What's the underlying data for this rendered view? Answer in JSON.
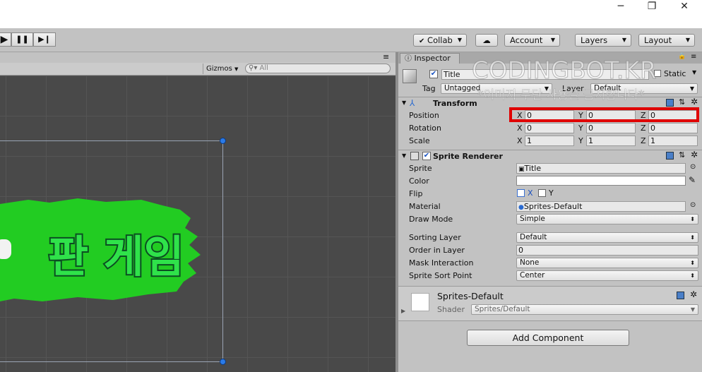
{
  "window": {
    "minimize": "─",
    "restore": "❐",
    "close": "✕"
  },
  "toolbar": {
    "play_icon": "▶",
    "pause_icon": "❚❚",
    "step_icon": "▶❙",
    "collab": "Collab",
    "cloud_icon": "☁",
    "account": "Account",
    "layers": "Layers",
    "layout": "Layout"
  },
  "scene": {
    "tab_menu": "≡",
    "gizmos": "Gizmos",
    "search_placeholder": "All",
    "sprite_text": "판 게임",
    "sprite_color": "#22cc22"
  },
  "inspector": {
    "tab_label": "Inspector",
    "lock_icon": "🔒",
    "menu_icon": "≡",
    "object_name": "Title",
    "static_label": "Static",
    "tag_label": "Tag",
    "tag_value": "Untagged",
    "layer_label": "Layer",
    "layer_value": "Default",
    "watermark": "CODINGBOT.KR",
    "watermark_sub": "*이미지 무단 사용을 금지합니다*",
    "transform": {
      "title": "Transform",
      "rows": [
        {
          "label": "Position",
          "x": "0",
          "y": "0",
          "z": "0"
        },
        {
          "label": "Rotation",
          "x": "0",
          "y": "0",
          "z": "0"
        },
        {
          "label": "Scale",
          "x": "1",
          "y": "1",
          "z": "1"
        }
      ],
      "axis_x": "X",
      "axis_y": "Y",
      "axis_z": "Z"
    },
    "sprite_renderer": {
      "title": "Sprite Renderer",
      "sprite_label": "Sprite",
      "sprite_value": "Title",
      "color_label": "Color",
      "flip_label": "Flip",
      "flip_x": "X",
      "flip_y": "Y",
      "material_label": "Material",
      "material_value": "Sprites-Default",
      "draw_mode_label": "Draw Mode",
      "draw_mode_value": "Simple",
      "sorting_layer_label": "Sorting Layer",
      "sorting_layer_value": "Default",
      "order_label": "Order in Layer",
      "order_value": "0",
      "mask_label": "Mask Interaction",
      "mask_value": "None",
      "sort_point_label": "Sprite Sort Point",
      "sort_point_value": "Center"
    },
    "material": {
      "name": "Sprites-Default",
      "shader_label": "Shader",
      "shader_value": "Sprites/Default"
    },
    "add_component": "Add Component",
    "highlight_color": "#e00000"
  }
}
